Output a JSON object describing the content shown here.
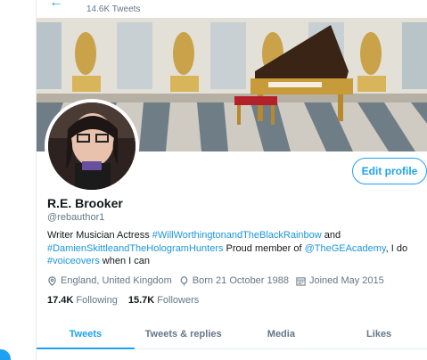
{
  "header": {
    "tweet_count": "14.6K Tweets"
  },
  "profile": {
    "name": "R.E. Brooker",
    "handle": "@rebauthor1",
    "edit_button": "Edit profile",
    "bio": [
      {
        "text": "Writer Musician Actress ",
        "link": false
      },
      {
        "text": "#WillWorthingtonandTheBlackRainbow",
        "link": true
      },
      {
        "text": " and ",
        "link": false
      },
      {
        "text": "#DamienSkittleandTheHologramHunters",
        "link": true
      },
      {
        "text": " Proud member of ",
        "link": false
      },
      {
        "text": "@TheGEAcademy",
        "link": true
      },
      {
        "text": ", I do ",
        "link": false
      },
      {
        "text": "#voiceovers",
        "link": true
      },
      {
        "text": " when I can",
        "link": false
      }
    ],
    "location": "England, United Kingdom",
    "born": "Born 21 October 1988",
    "joined": "Joined May 2015",
    "following_count": "17.4K",
    "following_label": "Following",
    "followers_count": "15.7K",
    "followers_label": "Followers"
  },
  "tabs": [
    "Tweets",
    "Tweets & replies",
    "Media",
    "Likes"
  ],
  "colors": {
    "accent": "#1da1f2",
    "secondary_text": "#657786",
    "primary_text": "#14171a"
  }
}
